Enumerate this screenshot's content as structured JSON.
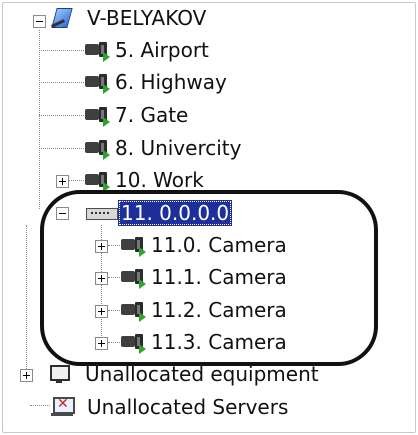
{
  "tree": {
    "root": {
      "label": "V-BELYAKOV",
      "icon": "server-pen-icon",
      "expanded": true
    },
    "cameras": [
      {
        "label": "5. Airport",
        "icon": "camera-icon"
      },
      {
        "label": "6. Highway",
        "icon": "camera-icon"
      },
      {
        "label": "7. Gate",
        "icon": "camera-icon"
      },
      {
        "label": "8. Univercity",
        "icon": "camera-icon"
      },
      {
        "label": "10. Work",
        "icon": "camera-icon",
        "expandable": true
      }
    ],
    "device": {
      "label": "11. 0.0.0.0",
      "icon": "ip-device-icon",
      "expanded": true,
      "selected": true,
      "children": [
        {
          "label": "11.0. Camera",
          "icon": "camera-icon"
        },
        {
          "label": "11.1. Camera",
          "icon": "camera-icon"
        },
        {
          "label": "11.2. Camera",
          "icon": "camera-icon"
        },
        {
          "label": "11.3. Camera",
          "icon": "camera-icon"
        }
      ]
    },
    "unallocated_equipment": {
      "label": "Unallocated equipment",
      "icon": "equipment-icon"
    },
    "unallocated_servers": {
      "label": "Unallocated Servers",
      "icon": "server-error-icon"
    }
  },
  "colors": {
    "selection": "#1f2f9a",
    "camera_flag": "#2da52d",
    "annotation": "#111111"
  }
}
